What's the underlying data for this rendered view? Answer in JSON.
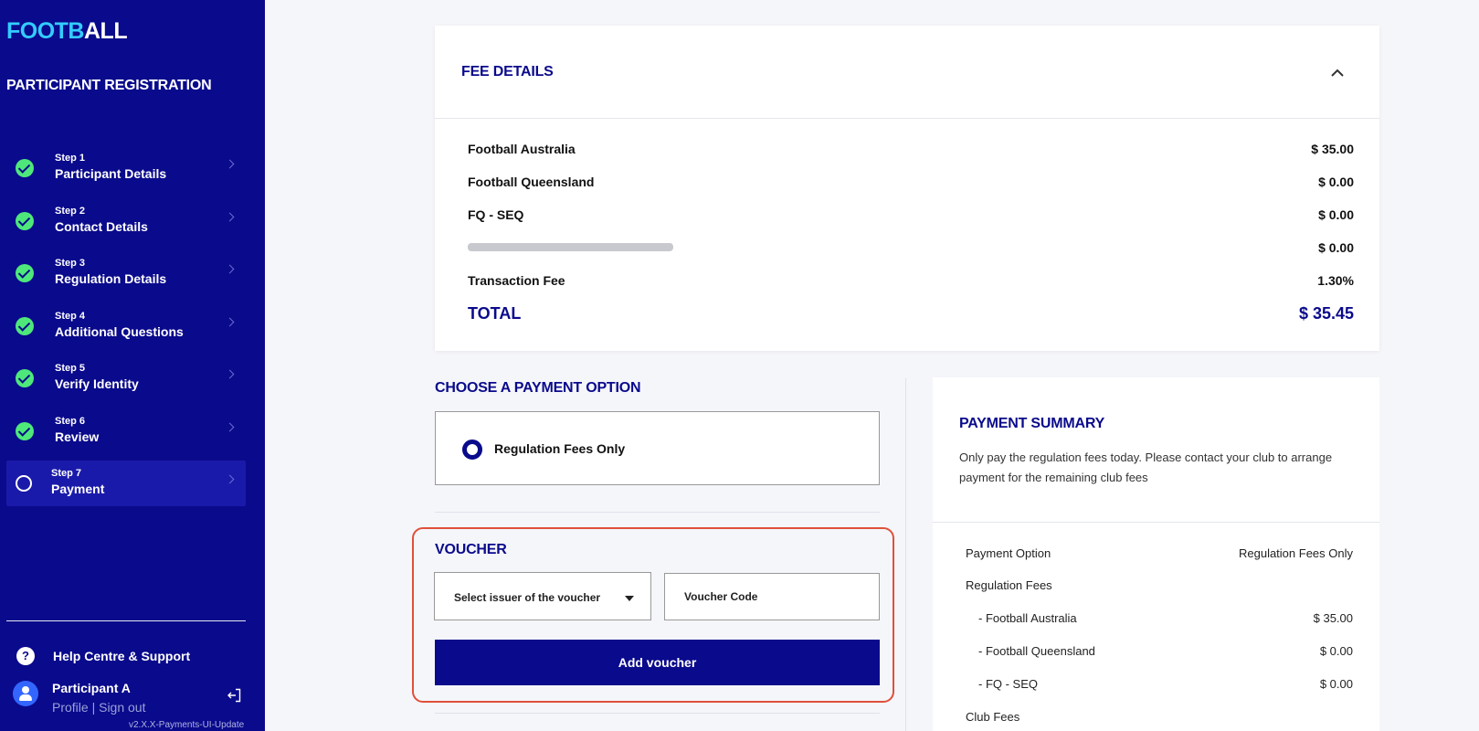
{
  "sidebar": {
    "logo_part1": "FOOTB",
    "logo_part2": "ALL",
    "title": "PARTICIPANT REGISTRATION",
    "steps": [
      {
        "num": "Step 1",
        "name": "Participant Details",
        "status": "done"
      },
      {
        "num": "Step 2",
        "name": "Contact Details",
        "status": "done"
      },
      {
        "num": "Step 3",
        "name": "Regulation Details",
        "status": "done"
      },
      {
        "num": "Step 4",
        "name": "Additional Questions",
        "status": "done"
      },
      {
        "num": "Step 5",
        "name": "Verify Identity",
        "status": "done"
      },
      {
        "num": "Step 6",
        "name": "Review",
        "status": "done"
      },
      {
        "num": "Step 7",
        "name": "Payment",
        "status": "current"
      }
    ],
    "help_icon_glyph": "?",
    "help_label": "Help Centre & Support",
    "user_name": "Participant A",
    "profile_link": "Profile",
    "link_separator": "|",
    "signout_link": "Sign out",
    "version": "v2.X.X-Payments-UI-Update"
  },
  "fee_details": {
    "title": "FEE DETAILS",
    "rows": [
      {
        "label": "Football Australia",
        "value": "$ 35.00"
      },
      {
        "label": "Football Queensland",
        "value": "$ 0.00"
      },
      {
        "label": "FQ - SEQ",
        "value": "$ 0.00"
      },
      {
        "label": "",
        "value": "$ 0.00"
      },
      {
        "label": "Transaction Fee",
        "value": "1.30%"
      }
    ],
    "total_label": "TOTAL",
    "total_value": "$ 35.45"
  },
  "payment_option": {
    "title": "CHOOSE A PAYMENT OPTION",
    "selected_option": "Regulation Fees Only"
  },
  "voucher": {
    "title": "VOUCHER",
    "select_placeholder": "Select issuer of the voucher",
    "code_placeholder": "Voucher Code",
    "add_button": "Add voucher"
  },
  "summary": {
    "title": "PAYMENT SUMMARY",
    "description": "Only pay the regulation fees today. Please contact your club to arrange payment for the remaining club fees",
    "rows": [
      {
        "label": "Payment Option",
        "value": "Regulation Fees Only"
      },
      {
        "label": "Regulation Fees",
        "value": ""
      },
      {
        "label": "- Football Australia",
        "value": "$ 35.00"
      },
      {
        "label": "- Football Queensland",
        "value": "$ 0.00"
      },
      {
        "label": "- FQ - SEQ",
        "value": "$ 0.00"
      },
      {
        "label": "Club Fees",
        "value": ""
      }
    ]
  },
  "colors": {
    "brand_navy": "#0a0a8c",
    "logo_accent": "#33ccff",
    "step_done": "#4ee87a",
    "highlight": "#e0503a"
  }
}
